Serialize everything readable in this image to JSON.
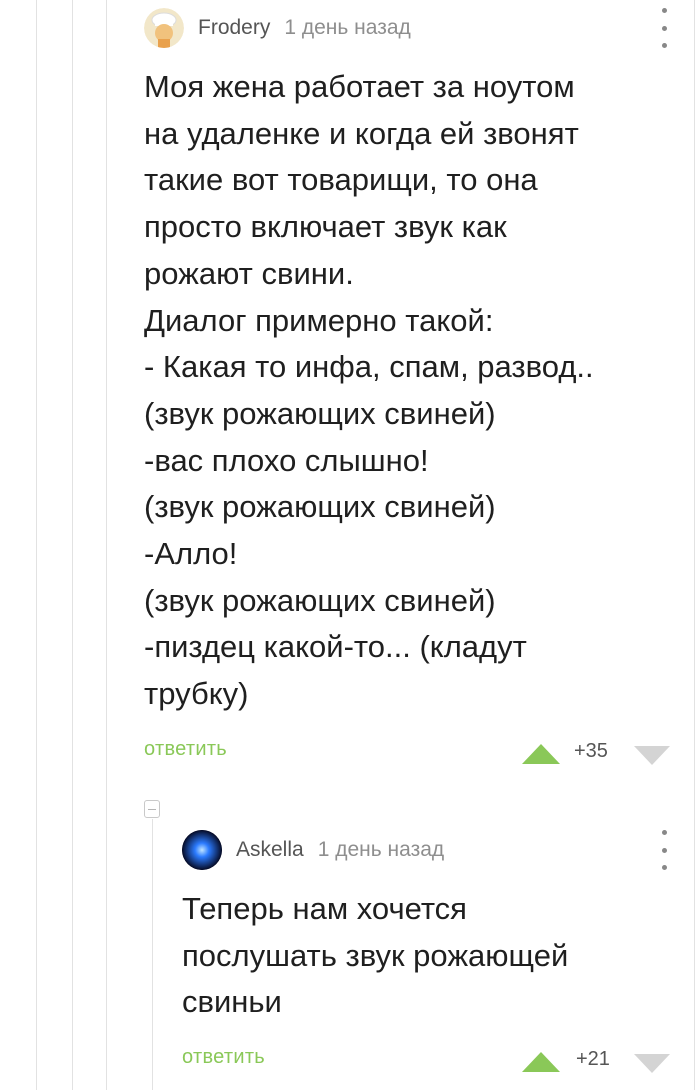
{
  "comment": {
    "author": "Frodery",
    "time": "1 день назад",
    "text": "Моя жена работает за ноутом\nна удаленке и когда ей звонят\nтакие вот товарищи, то она\nпросто включает звук как\nрожают свини.\nДиалог примерно такой:\n- Какая то инфа, спам, развод..\n(звук рожающих свиней)\n-вас плохо слышно!\n(звук рожающих свиней)\n-Алло!\n(звук рожающих свиней)\n-пиздец какой-то... (кладут\nтрубку)",
    "reply_label": "ответить",
    "score": "+35",
    "avatar_icon": "chef-avatar-icon"
  },
  "reply": {
    "author": "Askella",
    "time": "1 день назад",
    "text": "Теперь нам хочется\nпослушать звук рожающей\nсвиньи",
    "reply_label": "ответить",
    "score": "+21",
    "avatar_icon": "blue-orb-avatar-icon"
  },
  "colors": {
    "accent_green": "#8ac858",
    "downvote_gray": "#d4d4d4",
    "thread_line": "#e2e2e2"
  }
}
